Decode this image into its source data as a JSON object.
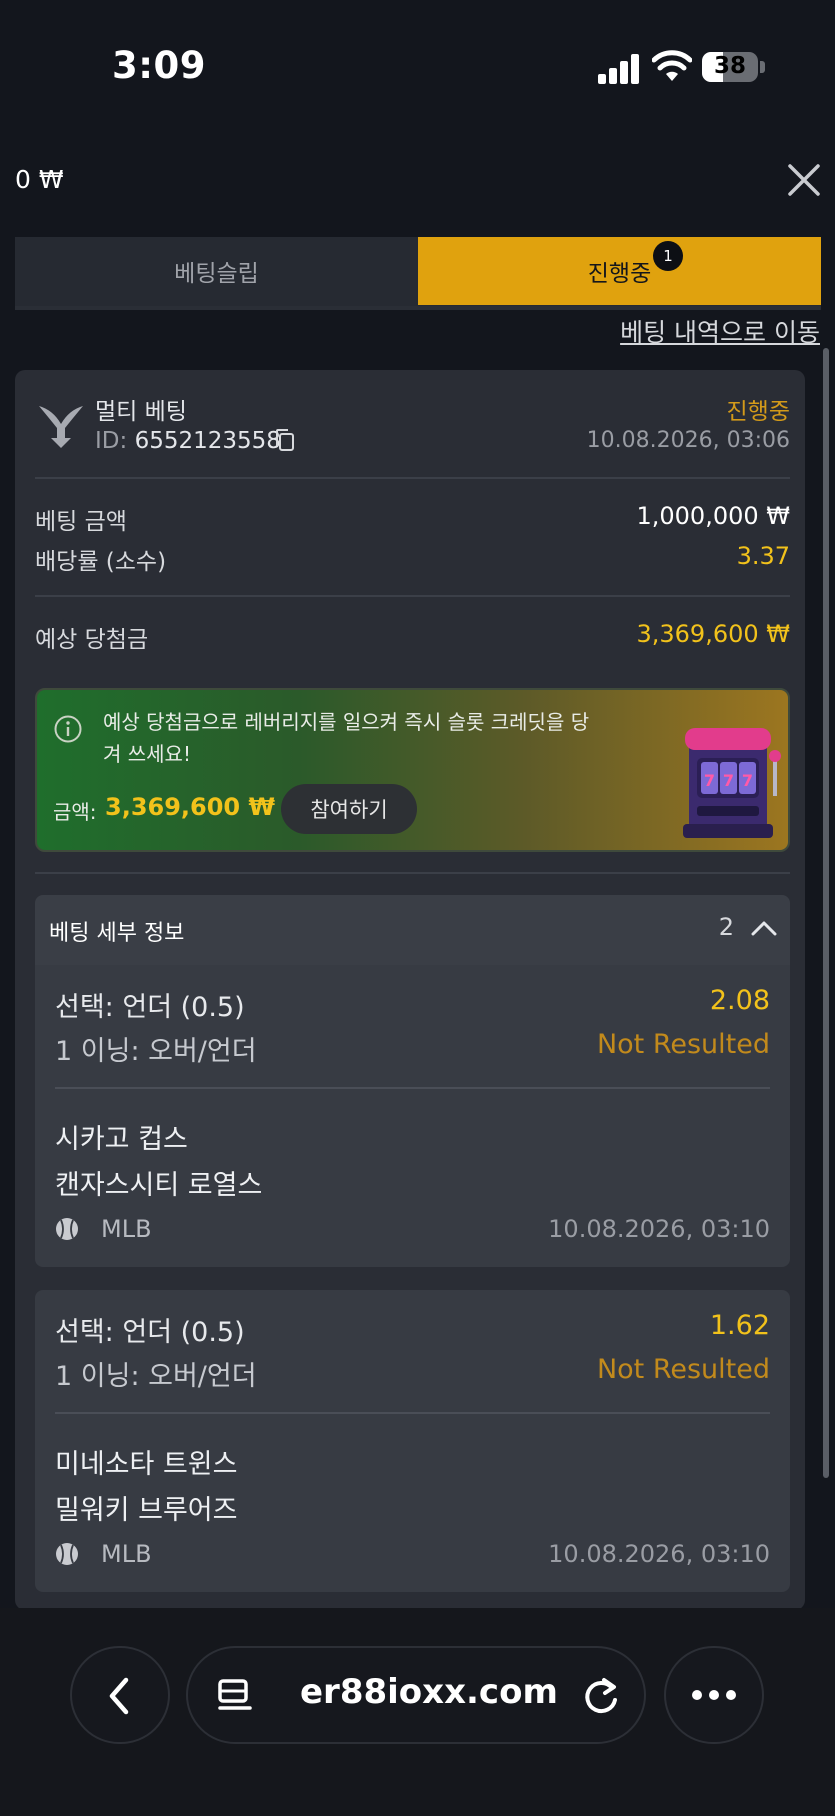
{
  "status_bar": {
    "time": "3:09",
    "battery": "38"
  },
  "top": {
    "balance": "0 ₩"
  },
  "tabs": [
    {
      "label": "베팅슬립"
    },
    {
      "label": "진행중",
      "badge": "1"
    }
  ],
  "history_link": "베팅 내역으로 이동",
  "bet": {
    "type": "멀티 베팅",
    "id_label": "ID:",
    "id_value": "6552123558",
    "status": "진행중",
    "date": "10.08.2026, 03:06",
    "stake_label": "베팅 금액",
    "stake_value": "1,000,000 ₩",
    "odds_label": "배당률 (소수)",
    "odds_value": "3.37",
    "potential_label": "예상 당첨금",
    "potential_value": "3,369,600 ₩"
  },
  "promo": {
    "text": "예상 당첨금으로 레버리지를 일으켜 즉시 슬롯 크레딧을 당겨 쓰세요!",
    "amount_label": "금액:",
    "amount_value": "3,369,600 ₩",
    "join_label": "참여하기"
  },
  "details": {
    "title": "베팅 세부 정보",
    "count": "2",
    "selections": [
      {
        "pick": "선택: 언더 (0.5)",
        "market": "1 이닝: 오버/언더",
        "odds": "2.08",
        "result": "Not Resulted",
        "team1": "시카고 컵스",
        "team2": "캔자스시티 로열스",
        "league": "MLB",
        "date": "10.08.2026, 03:10"
      },
      {
        "pick": "선택: 언더 (0.5)",
        "market": "1 이닝: 오버/언더",
        "odds": "1.62",
        "result": "Not Resulted",
        "team1": "미네소타 트윈스",
        "team2": "밀워키 브루어즈",
        "league": "MLB",
        "date": "10.08.2026, 03:10"
      }
    ]
  },
  "browser": {
    "url": "er88ioxx.com"
  },
  "colors": {
    "accent": "#e0a20e",
    "gold": "#f2c21b",
    "status": "#d39a1a",
    "background": "#13161d"
  },
  "icons": [
    "signal-icon",
    "wifi-icon",
    "battery-icon",
    "close-icon",
    "multi-bet-icon",
    "copy-icon",
    "info-icon",
    "slot-machine-icon",
    "chevron-up-icon",
    "baseball-icon",
    "back-icon",
    "tabs-icon",
    "reload-icon",
    "more-icon"
  ]
}
